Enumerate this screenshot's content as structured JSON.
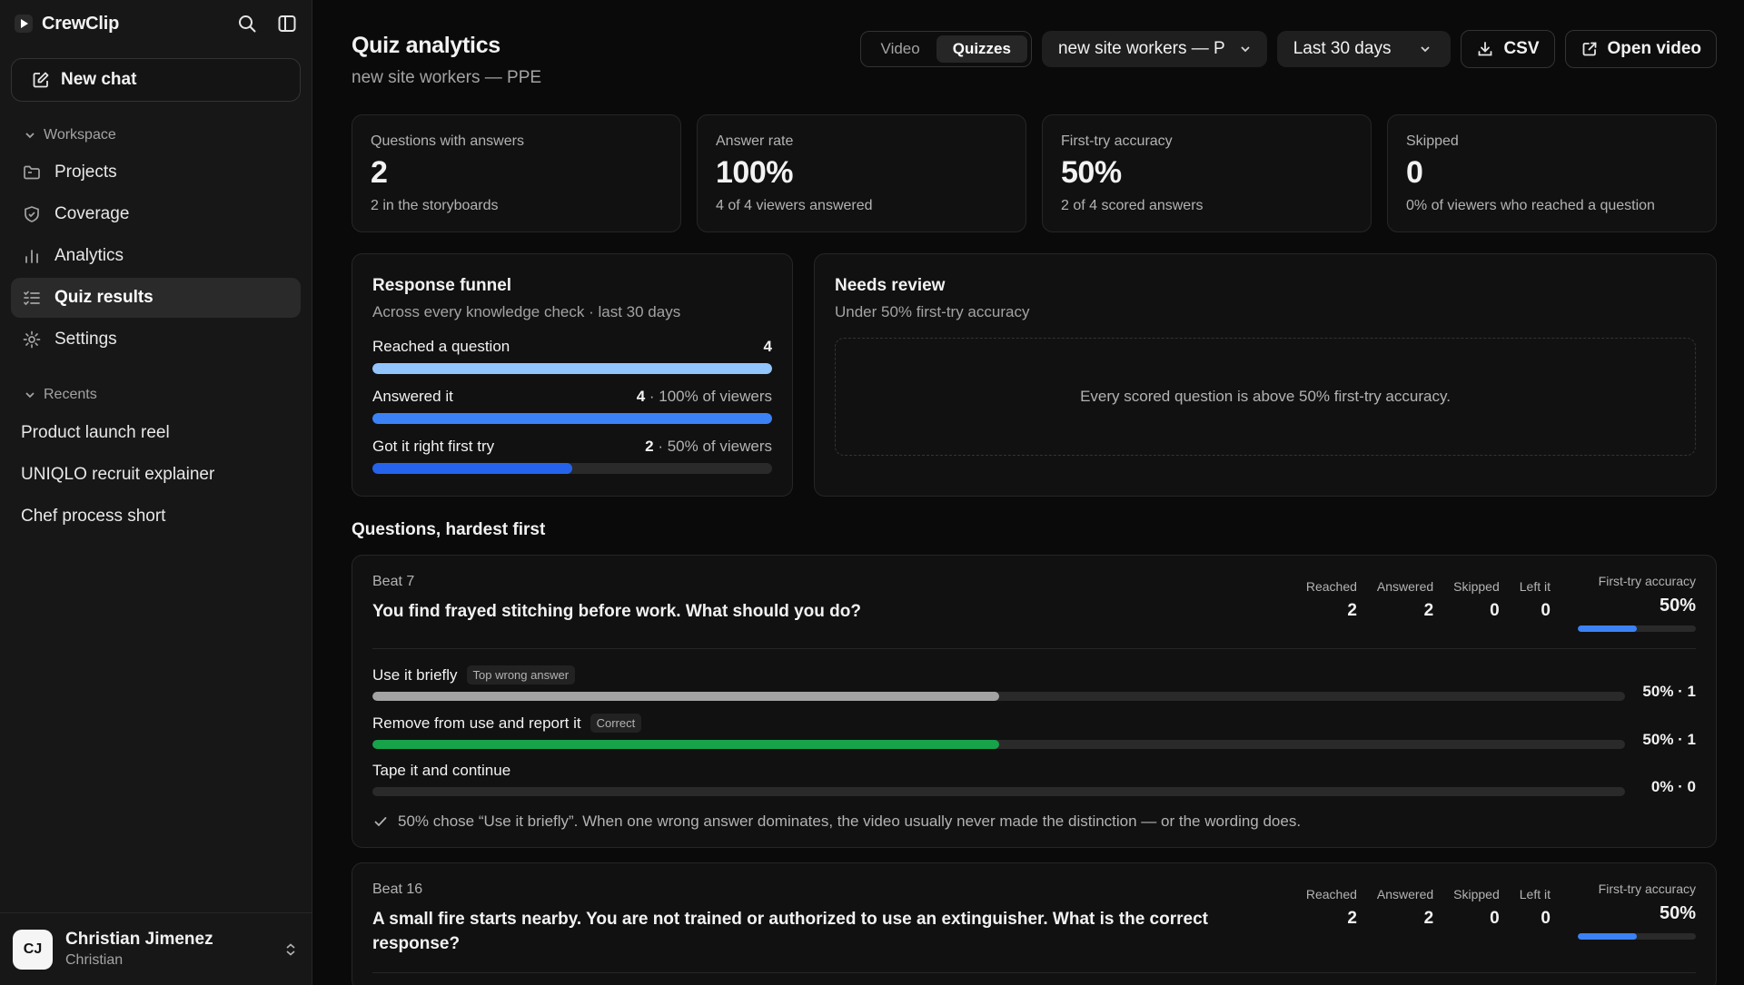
{
  "app": {
    "name": "CrewClip",
    "new_chat_label": "New chat"
  },
  "sidebar": {
    "workspace_label": "Workspace",
    "nav": [
      {
        "label": "Projects",
        "icon": "folder-icon"
      },
      {
        "label": "Coverage",
        "icon": "shield-icon"
      },
      {
        "label": "Analytics",
        "icon": "bar-chart-icon"
      },
      {
        "label": "Quiz results",
        "icon": "list-check-icon",
        "active": true
      },
      {
        "label": "Settings",
        "icon": "gear-icon"
      }
    ],
    "recents_label": "Recents",
    "recents": [
      "Product launch reel",
      "UNIQLO recruit explainer",
      "Chef process short"
    ],
    "user": {
      "initials": "CJ",
      "name": "Christian Jimenez",
      "sub": "Christian"
    }
  },
  "header": {
    "title": "Quiz analytics",
    "subtitle": "new site workers — PPE",
    "tabs": [
      "Video",
      "Quizzes"
    ],
    "active_tab": "Quizzes",
    "project_select": "new site workers — P",
    "range_select": "Last 30 days",
    "csv_label": "CSV",
    "open_video_label": "Open video"
  },
  "stats": [
    {
      "label": "Questions with answers",
      "value": "2",
      "note": "2 in the storyboards"
    },
    {
      "label": "Answer rate",
      "value": "100%",
      "note": "4 of 4 viewers answered"
    },
    {
      "label": "First-try accuracy",
      "value": "50%",
      "note": "2 of 4 scored answers"
    },
    {
      "label": "Skipped",
      "value": "0",
      "note": "0% of viewers who reached a question"
    }
  ],
  "funnel": {
    "title": "Response funnel",
    "subtitle": "Across every knowledge check · last 30 days",
    "rows": [
      {
        "label": "Reached a question",
        "count": "4",
        "suffix": "",
        "fraction": 1.0,
        "color": "#93c5fd"
      },
      {
        "label": "Answered it",
        "count": "4",
        "suffix": " · 100% of viewers",
        "fraction": 1.0,
        "color": "#3b82f6"
      },
      {
        "label": "Got it right first try",
        "count": "2",
        "suffix": " · 50% of viewers",
        "fraction": 0.5,
        "color": "#2563eb"
      }
    ]
  },
  "review": {
    "title": "Needs review",
    "subtitle": "Under 50% first-try accuracy",
    "empty": "Every scored question is above 50% first-try accuracy."
  },
  "questions": {
    "heading": "Questions, hardest first",
    "metric_labels": {
      "reached": "Reached",
      "answered": "Answered",
      "skipped": "Skipped",
      "left": "Left it",
      "accuracy": "First-try accuracy"
    },
    "items": [
      {
        "beat": "Beat 7",
        "text": "You find frayed stitching before work. What should you do?",
        "reached": "2",
        "answered": "2",
        "skipped": "0",
        "left": "0",
        "accuracy": "50%",
        "accuracy_fraction": 0.5,
        "answers": [
          {
            "label": "Use it briefly",
            "tag": "Top wrong answer",
            "pct": "50% · 1",
            "fraction": 0.5,
            "color": "#a3a3a3"
          },
          {
            "label": "Remove from use and report it",
            "tag": "Correct",
            "pct": "50% · 1",
            "fraction": 0.5,
            "color": "#16a34a"
          },
          {
            "label": "Tape it and continue",
            "tag": "",
            "pct": "0% · 0",
            "fraction": 0.0,
            "color": "#a3a3a3"
          }
        ],
        "insight": "50% chose “Use it briefly”. When one wrong answer dominates, the video usually never made the distinction — or the wording does."
      },
      {
        "beat": "Beat 16",
        "text": "A small fire starts nearby. You are not trained or authorized to use an extinguisher. What is the correct response?",
        "reached": "2",
        "answered": "2",
        "skipped": "0",
        "left": "0",
        "accuracy": "50%",
        "accuracy_fraction": 0.5,
        "answers": [],
        "insight": ""
      }
    ]
  },
  "colors": {
    "accent": "#3b82f6",
    "correct": "#16a34a",
    "neutral": "#a3a3a3"
  }
}
